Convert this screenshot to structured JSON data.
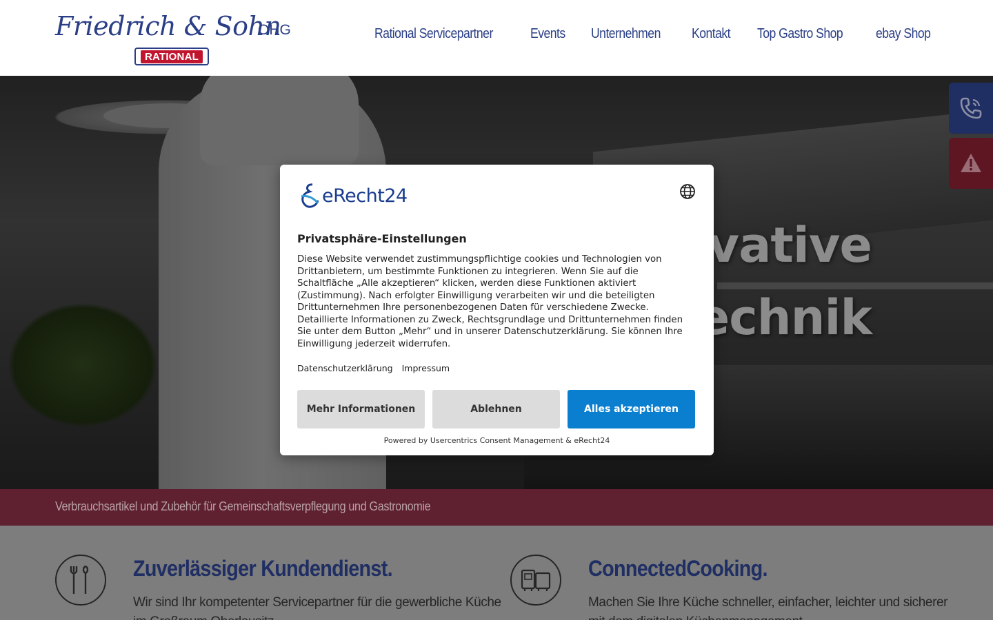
{
  "header": {
    "logo_text": "Friedrich & Sohn",
    "logo_suffix": "OHG",
    "logo_badge": "RATIONAL",
    "nav": [
      {
        "label": "Rational Servicepartner"
      },
      {
        "label": "Events"
      },
      {
        "label": "Unternehmen"
      },
      {
        "label": "Kontakt"
      },
      {
        "label": "Top Gastro Shop"
      },
      {
        "label": "ebay Shop"
      }
    ]
  },
  "hero": {
    "line1": "ovative",
    "line2": "technik"
  },
  "side_buttons": {
    "phone_icon": "phone-icon",
    "alert_icon": "warning-icon"
  },
  "subbanner": {
    "text": "Verbrauchsartikel und Zubehör für Gemeinschaftsverpflegung und Gastronomie"
  },
  "features": [
    {
      "icon": "tools-icon",
      "title": "Zuverlässiger Kundendienst.",
      "text": "Wir sind Ihr kompetenter Servicepartner für die gewerbliche Küche im Großraum Oberlausitz."
    },
    {
      "icon": "oven-icon",
      "title": "ConnectedCooking.",
      "text": "Machen Sie Ihre Küche schneller, einfacher, leichter und sicherer mit dem digitalen Küchenmanagement."
    }
  ],
  "consent": {
    "brand": "eRecht24",
    "title": "Privatsphäre-Einstellungen",
    "body": "Diese Website verwendet zustimmungspflichtige cookies und Technologien von Drittanbietern, um bestimmte Funktionen zu integrieren. Wenn Sie auf die Schaltfläche „Alle akzeptieren“ klicken, werden diese Funktionen aktiviert (Zustimmung). Nach erfolgter Einwilligung verarbeiten wir und die beteiligten Drittunternehmen Ihre personenbezogenen Daten für verschiedene Zwecke. Detaillierte Informationen zu Zweck, Rechtsgrundlage und Drittunternehmen finden Sie unter dem Button „Mehr“ und in unserer Datenschutzerklärung. Sie können Ihre Einwilligung jederzeit widerrufen.",
    "link_privacy": "Datenschutzerklärung",
    "link_imprint": "Impressum",
    "btn_more": "Mehr Informationen",
    "btn_decline": "Ablehnen",
    "btn_accept": "Alles akzeptieren",
    "powered": "Powered by Usercentrics Consent Management & eRecht24",
    "accent_color": "#0a7fd0"
  }
}
